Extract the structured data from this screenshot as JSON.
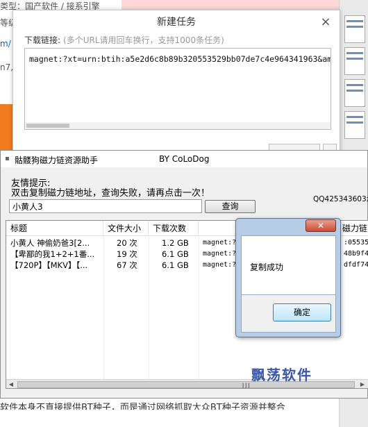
{
  "background_page": {
    "left_texts": [
      "类型：国产软件 / 接系引擎",
      "等级",
      "m/",
      "n7,"
    ],
    "bottom_text": "软件本身不直接提供BT种子，而是通过网络抓取大众BT种子资源并整合"
  },
  "task_dialog": {
    "title": "新建任务",
    "close_glyph": "×",
    "link_label": "下载链接:",
    "link_hint": "(多个URL请用回车换行，支持1000条任务)",
    "link_value": "magnet:?xt=urn:btih:a5e2d6c8b89b320553529bb07de7c4e964341963&am"
  },
  "app": {
    "title": "骷髅狗磁力链资源助手",
    "author": "BY CoLoDog",
    "tip_title": "友情提示:",
    "tip_text": "双击复制磁力链地址，查询失败，请再点击一次！",
    "qq": "QQ425343603承",
    "search_value": "小黄人3",
    "query_button": "查询",
    "columns": [
      "标题",
      "文件大小",
      "下载次数",
      "",
      "磁力链"
    ],
    "rows": [
      {
        "title": "小黄人 神偷奶爸3[2...",
        "count": "20 次",
        "size": "1.2  GB",
        "link": "magnet:?",
        "hash": ":055352"
      },
      {
        "title": "【卑鄙的我1+2+1番...",
        "count": "19 次",
        "size": "6.1  GB",
        "link": "magnet:?",
        "hash": "48b9f4"
      },
      {
        "title": "【720P】【MKV】【...",
        "count": "67 次",
        "size": "6.1  GB",
        "link": "magnet:?",
        "hash": "dfdf74"
      }
    ],
    "watermark": "飘荡软件"
  },
  "msgbox": {
    "close_glyph": "✕",
    "message": "复制成功",
    "ok_button": "确定"
  }
}
